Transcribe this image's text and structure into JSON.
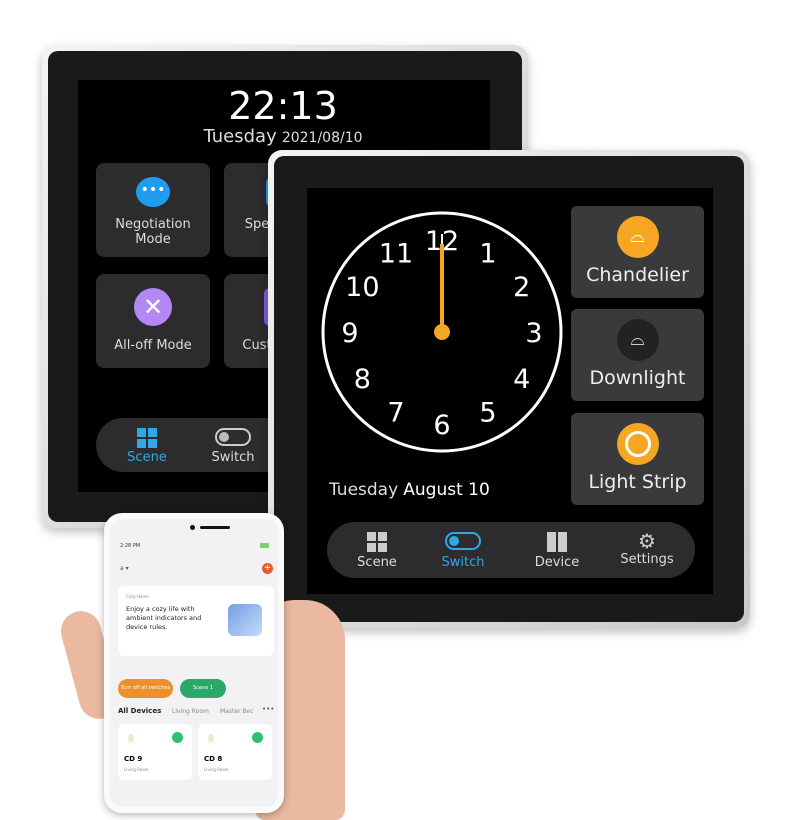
{
  "back_panel": {
    "time": "22:13",
    "day": "Tuesday",
    "date": "2021/08/10",
    "tiles": [
      {
        "label": "Negotiation Mode",
        "icon": "chat-bubbles-icon",
        "color": "#1f9bf0"
      },
      {
        "label": "Spee",
        "icon": "speech-icon",
        "color": "#1f9bf0"
      },
      {
        "label": "All-off Mode",
        "icon": "close-circle-icon",
        "color": "#b388f5"
      },
      {
        "label": "Custo",
        "icon": "custom-icon",
        "color": "#7b5ce0"
      }
    ],
    "nav": [
      {
        "label": "Scene",
        "icon": "grid-icon",
        "active": true
      },
      {
        "label": "Switch",
        "icon": "toggle-icon",
        "active": false
      }
    ]
  },
  "front_panel": {
    "clock": {
      "numerals": [
        "12",
        "1",
        "2",
        "3",
        "4",
        "5",
        "6",
        "7",
        "8",
        "9",
        "10",
        "11"
      ],
      "hour": 12,
      "minute": 0
    },
    "day": "Tuesday",
    "date": "August 10",
    "tiles": [
      {
        "label": "Chandelier",
        "icon": "chandelier-icon",
        "on": true
      },
      {
        "label": "Downlight",
        "icon": "downlight-icon",
        "on": false
      },
      {
        "label": "Light Strip",
        "icon": "light-strip-icon",
        "on": true
      }
    ],
    "nav": [
      {
        "label": "Scene",
        "icon": "grid-icon",
        "active": false
      },
      {
        "label": "Switch",
        "icon": "toggle-icon",
        "active": true
      },
      {
        "label": "Device",
        "icon": "device-icon",
        "active": false
      },
      {
        "label": "Settings",
        "icon": "gear-icon",
        "active": false
      }
    ],
    "accent": "#f5a623",
    "active_color": "#2fa8e8"
  },
  "phone": {
    "status_time": "2:28 PM",
    "home_selector": "a",
    "banner_title": "Cozy Home",
    "banner_text": "Enjoy a cozy life with ambient indicators and device rules.",
    "buttons": [
      {
        "label": "Turn off all switches",
        "color": "#ec8f2c"
      },
      {
        "label": "Scene 1",
        "color": "#2aa86a"
      }
    ],
    "tabs": [
      "All Devices",
      "Living Room",
      "Master Bec"
    ],
    "devices": [
      {
        "name": "CD 9",
        "room": "Living Room"
      },
      {
        "name": "CD 8",
        "room": "Living Room"
      }
    ]
  }
}
